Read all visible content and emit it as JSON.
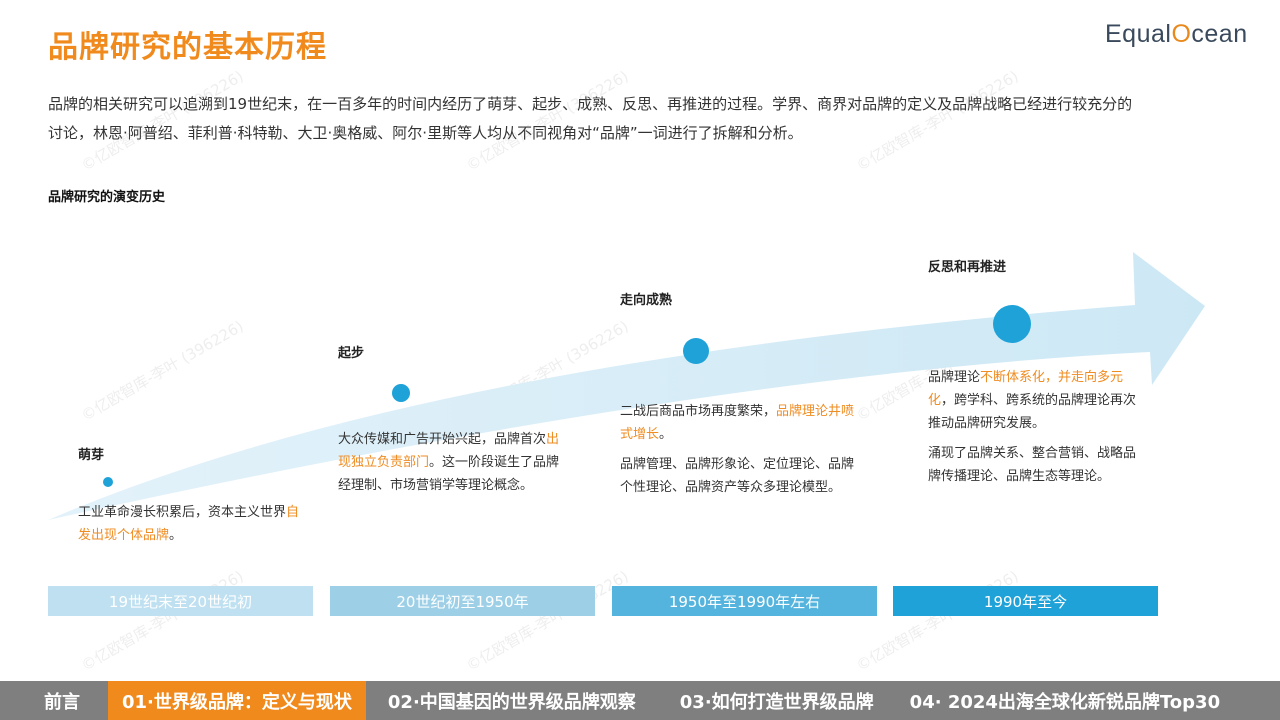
{
  "header": {
    "title": "品牌研究的基本历程",
    "logo_prefix": "Equal",
    "logo_accent": "O",
    "logo_suffix": "cean"
  },
  "intro": {
    "line1": "品牌的相关研究可以追溯到19世纪末，在一百多年的时间内经历了萌芽、起步、成熟、反思、再推进的过程。学界、商界对品牌的定义及品牌战略已经进行较充分的",
    "line2": "讨论，林恩·阿普绍、菲利普·科特勒、大卫·奥格威、阿尔·里斯等人均从不同视角对“品牌”一词进行了拆解和分析。"
  },
  "section_title": "品牌研究的演变历史",
  "stages": [
    {
      "label": "萌芽",
      "paragraphs": [
        {
          "before": "工业革命漫长积累后，资本主义世界",
          "highlight": "自发出现个体品牌",
          "after": "。"
        }
      ],
      "period": "19世纪末至20世纪初",
      "period_color": "#bfe0f0"
    },
    {
      "label": "起步",
      "paragraphs": [
        {
          "before": "大众传媒和广告开始兴起，品牌首次",
          "highlight": "出现独立负责部门",
          "after": "。这一阶段诞生了品牌经理制、市场营销学等理论概念。"
        }
      ],
      "period": "20世纪初至1950年",
      "period_color": "#9dd0e7"
    },
    {
      "label": "走向成熟",
      "paragraphs": [
        {
          "before": "二战后商品市场再度繁荣，",
          "highlight": "品牌理论井喷式增长",
          "after": "。"
        },
        {
          "before": "品牌管理、品牌形象论、定位理论、品牌个性理论、品牌资产等众多理论模型。",
          "highlight": "",
          "after": ""
        }
      ],
      "period": "1950年至1990年左右",
      "period_color": "#55b4dd"
    },
    {
      "label": "反思和再推进",
      "paragraphs": [
        {
          "before": "品牌理论",
          "highlight": "不断体系化，并走向多元化",
          "after": "，跨学科、跨系统的品牌理论再次推动品牌研究发展。"
        },
        {
          "before": "涌现了品牌关系、整合营销、战略品牌传播理论、品牌生态等理论。",
          "highlight": "",
          "after": ""
        }
      ],
      "period": "1990年至今",
      "period_color": "#1ea2d8"
    }
  ],
  "watermark_text": "©亿欧智库-李叶 (396226)",
  "footer": {
    "items": [
      {
        "label": "前言",
        "active": false
      },
      {
        "label": "01·世界级品牌：定义与现状",
        "active": true
      },
      {
        "label": "02·中国基因的世界级品牌观察",
        "active": false
      },
      {
        "label": "03·如何打造世界级品牌",
        "active": false
      },
      {
        "label": "04· 2024出海全球化新锐品牌Top30",
        "active": false
      }
    ]
  },
  "colors": {
    "accent_orange": "#f08a1c",
    "arrow_fill": "#d3eaf5",
    "dot_blue": "#1ea2d8"
  }
}
